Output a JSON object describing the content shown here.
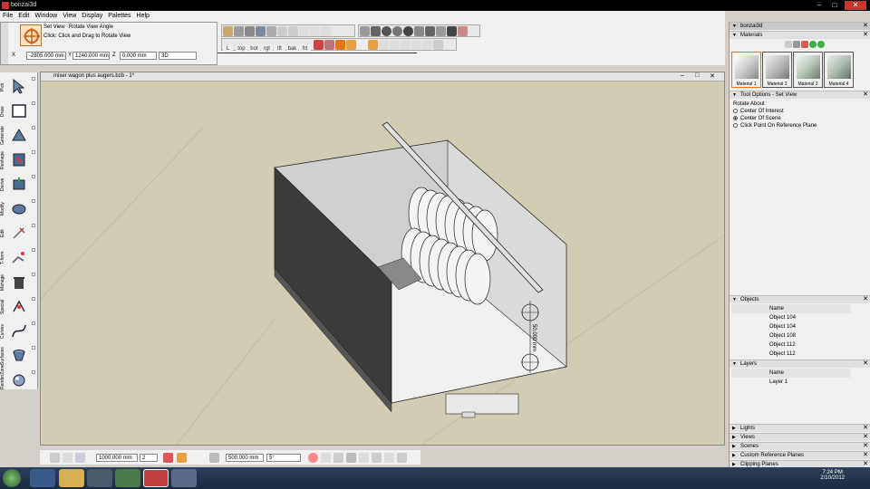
{
  "window": {
    "title": "bonzai3d",
    "minimize": "–",
    "maximize": "□",
    "close": "✕"
  },
  "menu": [
    "File",
    "Edit",
    "Window",
    "View",
    "Display",
    "Palettes",
    "Help"
  ],
  "tool_options": {
    "tool_name": "Set View",
    "tool_title": "Rotate View Angle",
    "instruction": "Click: Click and Drag to Rotate View",
    "x_label": "X",
    "x_value": "-2805.000 mm",
    "y_label": "Y",
    "y_value": "1240.000 mm",
    "z_label": "Z",
    "z_value": "0.000 mm",
    "mode": "3D"
  },
  "view_buttons": [
    "top",
    "bot",
    "rgt",
    "lft",
    "bak",
    "frt"
  ],
  "left_tools": [
    "Pick",
    "Draw",
    "Generate",
    "Reshape",
    "Derive",
    "Modify",
    "Edit",
    "T-form",
    "Manage",
    "Special",
    "Curves",
    "Surfaces",
    "RenderZone"
  ],
  "document": {
    "title": "mixer wagon plus augers.bzb - 1*"
  },
  "scene": {
    "dimension_label": "50.000 mm"
  },
  "bottom_bar": {
    "dist_value": "1000.000 mm",
    "count_value": "2",
    "snap_value": "500.000 mm",
    "angle_value": "5°"
  },
  "right_panel": {
    "title": "bonzai3d",
    "materials_header": "Materials",
    "materials": [
      "Material 1",
      "Material 2",
      "Material 3",
      "Material 4"
    ],
    "tool_options_header": "Tool Options - Set View",
    "rotate_about_label": "Rotate About",
    "rotate_options": [
      "Center Of Interest",
      "Center Of Scene",
      "Click Point On Reference Plane"
    ],
    "rotate_selected": 1,
    "objects_header": "Objects",
    "objects_name_col": "Name",
    "objects": [
      "Object 104",
      "Object 104",
      "Object 108",
      "Object 112",
      "Object 112"
    ],
    "layers_header": "Layers",
    "layers_name_col": "Name",
    "layers": [
      "Layer 1"
    ],
    "collapsed_panels": [
      "Lights",
      "Views",
      "Scenes",
      "Custom Reference Planes",
      "Clipping Planes"
    ]
  },
  "taskbar": {
    "time": "7:24 PM",
    "date": "2/10/2012"
  },
  "colors": {
    "viewport": "#d2ccb2",
    "accent": "#3cb043",
    "highlight": "#e8731a"
  }
}
